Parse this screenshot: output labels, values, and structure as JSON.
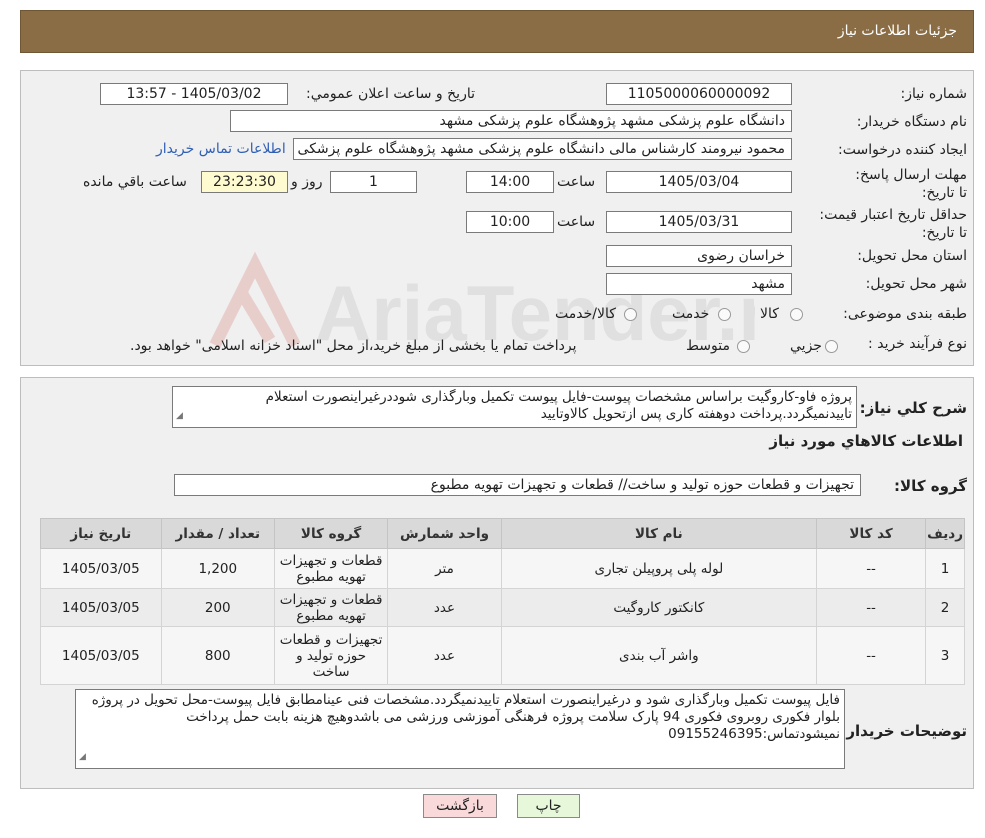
{
  "header": {
    "title": "جزئيات اطلاعات نياز"
  },
  "form": {
    "need_number_label": "شماره نياز:",
    "need_number": "1105000060000092",
    "announce_label": "تاريخ و ساعت اعلان عمومي:",
    "announce_value": "1405/03/02 - 13:57",
    "buyer_org_label": "نام دستگاه خريدار:",
    "buyer_org": "دانشگاه علوم پزشكی مشهد   پژوهشگاه علوم پزشكی مشهد",
    "creator_label": "ايجاد کننده درخواست:",
    "creator": "محمود نيرومند كارشناس مالی دانشگاه علوم پزشكی مشهد   پژوهشگاه علوم پزشكی مشهد",
    "contact_link": "اطلاعات تماس خريدار",
    "reply_deadline_label": "مهلت ارسال پاسخ: تا تاريخ:",
    "reply_date": "1405/03/04",
    "time_label": "ساعت",
    "reply_time": "14:00",
    "days_value": "1",
    "days_label": "روز و",
    "remaining_time": "23:23:30",
    "remaining_label": "ساعت باقي مانده",
    "price_validity_label": "حداقل تاريخ اعتبار قيمت: تا تاريخ:",
    "validity_date": "1405/03/31",
    "validity_time": "10:00",
    "province_label": "استان محل تحويل:",
    "province": "خراسان رضوی",
    "city_label": "شهر محل تحويل:",
    "city": "مشهد",
    "category_label": "طبقه بندی موضوعی:",
    "category_options": [
      "کالا",
      "خدمت",
      "کالا/خدمت"
    ],
    "process_label": "نوع فرآيند خريد :",
    "process_options": [
      "جزيي",
      "متوسط"
    ],
    "process_note": "پرداخت تمام يا بخشی از مبلغ خريد،از محل \"اسناد خزانه اسلامی\" خواهد بود."
  },
  "general": {
    "desc_label": "شرح كلي نياز:",
    "desc_text": "پروژه فاو-کاروگیت براساس مشخصات پیوست-فایل پیوست تکمیل وبارگذاری شوددرغیراینصورت استعلام تاییدنمیگردد.پرداخت دوهفته کاری پس ازتحویل کالاوتایید",
    "goods_info_title": "اطلاعات كالاهاي مورد نياز",
    "goods_group_label": "گروه كالا:",
    "goods_group": "تجهیزات و قطعات حوزه تولید و ساخت//  قطعات و تجهیزات تهویه مطبوع"
  },
  "table": {
    "headers": [
      "رديف",
      "كد كالا",
      "نام كالا",
      "واحد شمارش",
      "گروه كالا",
      "تعداد / مقدار",
      "تاريخ نياز"
    ],
    "rows": [
      {
        "row": "1",
        "code": "--",
        "name": "لوله پلی پروپیلن تجاری",
        "unit": "متر",
        "group": "قطعات و تجهیزات تهویه مطبوع",
        "qty": "1,200",
        "date": "1405/03/05"
      },
      {
        "row": "2",
        "code": "--",
        "name": "کانکتور کاروگیت",
        "unit": "عدد",
        "group": "قطعات و تجهیزات تهویه مطبوع",
        "qty": "200",
        "date": "1405/03/05"
      },
      {
        "row": "3",
        "code": "--",
        "name": "واشر آب بندی",
        "unit": "عدد",
        "group": "تجهیزات و قطعات حوزه تولید و ساخت",
        "qty": "800",
        "date": "1405/03/05"
      }
    ]
  },
  "buyer_notes": {
    "label": "توضيحات خريدار:",
    "text": "فایل پیوست تکمیل وبارگذاری شود و درغیراینصورت استعلام تاییدنمیگردد.مشخصات فنی عینامطابق فایل پیوست-محل تحویل در پروژه بلوار فکوری روبروی فکوری 94 پارک سلامت پروژه فرهنگی آموزشی ورزشی می باشدوهیچ هزینه بابت حمل پرداخت نمیشودتماس:09155246395"
  },
  "buttons": {
    "print": "چاپ",
    "back": "بازگشت"
  },
  "watermark": {
    "text": "AriaTender.neT"
  },
  "colors": {
    "header_bg": "#8b6d45",
    "print_btn": "#e6f7da",
    "back_btn": "#f9d9d9"
  }
}
